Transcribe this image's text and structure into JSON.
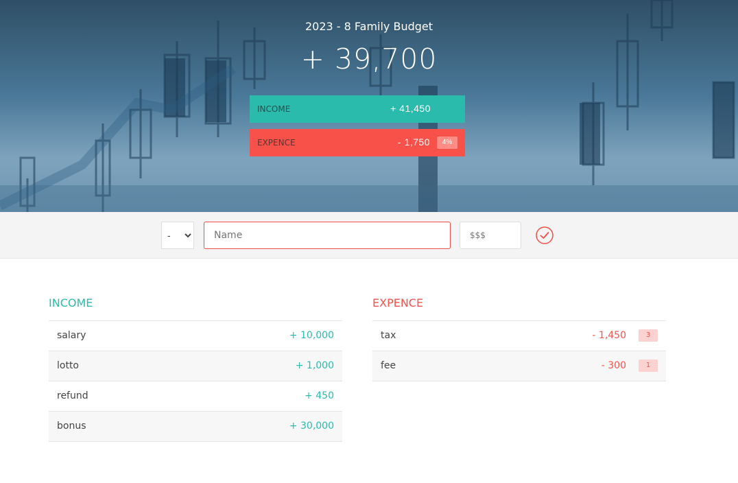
{
  "header": {
    "title": "2023 - 8 Family Budget",
    "total": "+ 39,700",
    "income_label": "INCOME",
    "income_total": "+ 41,450",
    "expense_label": "EXPENCE",
    "expense_total": "- 1,750",
    "expense_percent": "4%"
  },
  "form": {
    "type_options": [
      "-",
      "+"
    ],
    "type_selected": "-",
    "name_placeholder": "Name",
    "value_placeholder": "$$$",
    "submit_icon": "checkmark-circle-icon"
  },
  "income": {
    "heading": "INCOME",
    "items": [
      {
        "name": "salary",
        "value": "+ 10,000"
      },
      {
        "name": "lotto",
        "value": "+ 1,000"
      },
      {
        "name": "refund",
        "value": "+ 450"
      },
      {
        "name": "bonus",
        "value": "+ 30,000"
      }
    ]
  },
  "expense": {
    "heading": "EXPENCE",
    "items": [
      {
        "name": "tax",
        "value": "- 1,450",
        "percent": "3"
      },
      {
        "name": "fee",
        "value": "- 300",
        "percent": "1"
      }
    ]
  },
  "colors": {
    "income": "#2bbbad",
    "expense": "#f7514a"
  }
}
